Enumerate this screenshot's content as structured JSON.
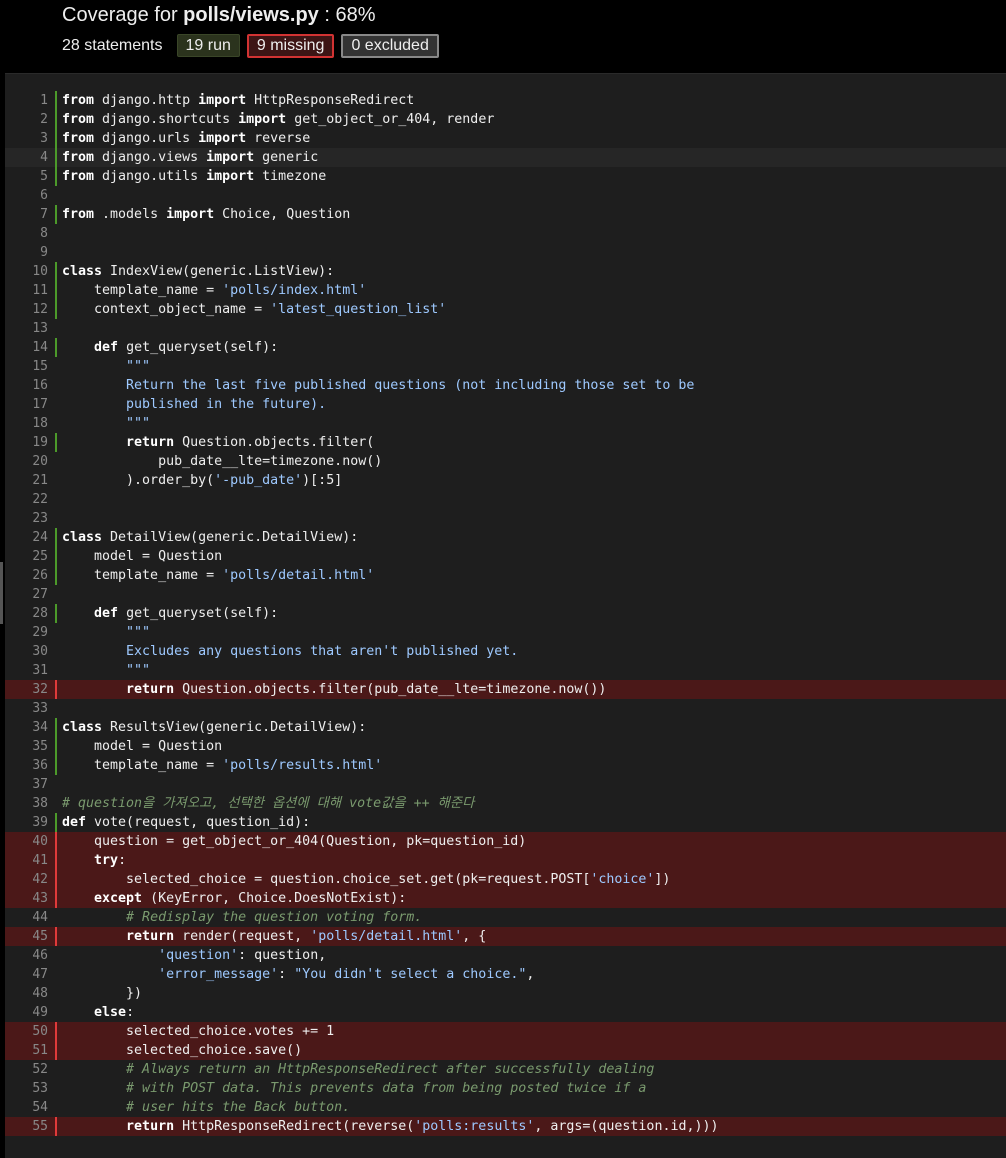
{
  "header": {
    "title_prefix": "Coverage for ",
    "file": "polls/views.py",
    "title_suffix": " : 68%",
    "statements": "28 statements",
    "run_button": "19 run",
    "missing_button": "9 missing",
    "excluded_button": "0 excluded"
  },
  "code": [
    {
      "n": "1",
      "st": "run",
      "toks": [
        [
          "k",
          "from"
        ],
        [
          "p",
          " django.http "
        ],
        [
          "k",
          "import"
        ],
        [
          "p",
          " HttpResponseRedirect"
        ]
      ]
    },
    {
      "n": "2",
      "st": "run",
      "toks": [
        [
          "k",
          "from"
        ],
        [
          "p",
          " django.shortcuts "
        ],
        [
          "k",
          "import"
        ],
        [
          "p",
          " get_object_or_404, render"
        ]
      ]
    },
    {
      "n": "3",
      "st": "run",
      "toks": [
        [
          "k",
          "from"
        ],
        [
          "p",
          " django.urls "
        ],
        [
          "k",
          "import"
        ],
        [
          "p",
          " reverse"
        ]
      ]
    },
    {
      "n": "4",
      "st": "run",
      "hl": true,
      "toks": [
        [
          "k",
          "from"
        ],
        [
          "p",
          " django.views "
        ],
        [
          "k",
          "import"
        ],
        [
          "p",
          " generic"
        ]
      ]
    },
    {
      "n": "5",
      "st": "run",
      "toks": [
        [
          "k",
          "from"
        ],
        [
          "p",
          " django.utils "
        ],
        [
          "k",
          "import"
        ],
        [
          "p",
          " timezone"
        ]
      ]
    },
    {
      "n": "6",
      "st": "",
      "toks": []
    },
    {
      "n": "7",
      "st": "run",
      "toks": [
        [
          "k",
          "from"
        ],
        [
          "p",
          " .models "
        ],
        [
          "k",
          "import"
        ],
        [
          "p",
          " Choice, Question"
        ]
      ]
    },
    {
      "n": "8",
      "st": "",
      "toks": []
    },
    {
      "n": "9",
      "st": "",
      "toks": []
    },
    {
      "n": "10",
      "st": "run",
      "toks": [
        [
          "k",
          "class"
        ],
        [
          "p",
          " IndexView(generic.ListView):"
        ]
      ]
    },
    {
      "n": "11",
      "st": "run",
      "toks": [
        [
          "p",
          "    template_name = "
        ],
        [
          "s",
          "'polls/index.html'"
        ]
      ]
    },
    {
      "n": "12",
      "st": "run",
      "toks": [
        [
          "p",
          "    context_object_name = "
        ],
        [
          "s",
          "'latest_question_list'"
        ]
      ]
    },
    {
      "n": "13",
      "st": "",
      "toks": []
    },
    {
      "n": "14",
      "st": "run",
      "toks": [
        [
          "p",
          "    "
        ],
        [
          "k",
          "def"
        ],
        [
          "p",
          " get_queryset(self):"
        ]
      ]
    },
    {
      "n": "15",
      "st": "",
      "toks": [
        [
          "p",
          "        "
        ],
        [
          "s",
          "\"\"\""
        ]
      ]
    },
    {
      "n": "16",
      "st": "",
      "toks": [
        [
          "s",
          "        Return the last five published questions (not including those set to be"
        ]
      ]
    },
    {
      "n": "17",
      "st": "",
      "toks": [
        [
          "s",
          "        published in the future)."
        ]
      ]
    },
    {
      "n": "18",
      "st": "",
      "toks": [
        [
          "p",
          "        "
        ],
        [
          "s",
          "\"\"\""
        ]
      ]
    },
    {
      "n": "19",
      "st": "run",
      "toks": [
        [
          "p",
          "        "
        ],
        [
          "k",
          "return"
        ],
        [
          "p",
          " Question.objects.filter("
        ]
      ]
    },
    {
      "n": "20",
      "st": "",
      "toks": [
        [
          "p",
          "            pub_date__lte=timezone.now()"
        ]
      ]
    },
    {
      "n": "21",
      "st": "",
      "toks": [
        [
          "p",
          "        ).order_by("
        ],
        [
          "s",
          "'-pub_date'"
        ],
        [
          "p",
          ")[:5]"
        ]
      ]
    },
    {
      "n": "22",
      "st": "",
      "toks": []
    },
    {
      "n": "23",
      "st": "",
      "toks": []
    },
    {
      "n": "24",
      "st": "run",
      "toks": [
        [
          "k",
          "class"
        ],
        [
          "p",
          " DetailView(generic.DetailView):"
        ]
      ]
    },
    {
      "n": "25",
      "st": "run",
      "toks": [
        [
          "p",
          "    model = Question"
        ]
      ]
    },
    {
      "n": "26",
      "st": "run",
      "toks": [
        [
          "p",
          "    template_name = "
        ],
        [
          "s",
          "'polls/detail.html'"
        ]
      ]
    },
    {
      "n": "27",
      "st": "",
      "toks": []
    },
    {
      "n": "28",
      "st": "run",
      "toks": [
        [
          "p",
          "    "
        ],
        [
          "k",
          "def"
        ],
        [
          "p",
          " get_queryset(self):"
        ]
      ]
    },
    {
      "n": "29",
      "st": "",
      "toks": [
        [
          "p",
          "        "
        ],
        [
          "s",
          "\"\"\""
        ]
      ]
    },
    {
      "n": "30",
      "st": "",
      "toks": [
        [
          "s",
          "        Excludes any questions that aren't published yet."
        ]
      ]
    },
    {
      "n": "31",
      "st": "",
      "toks": [
        [
          "p",
          "        "
        ],
        [
          "s",
          "\"\"\""
        ]
      ]
    },
    {
      "n": "32",
      "st": "mis",
      "toks": [
        [
          "p",
          "        "
        ],
        [
          "k",
          "return"
        ],
        [
          "p",
          " Question.objects.filter(pub_date__lte=timezone.now())"
        ]
      ]
    },
    {
      "n": "33",
      "st": "",
      "toks": []
    },
    {
      "n": "34",
      "st": "run",
      "toks": [
        [
          "k",
          "class"
        ],
        [
          "p",
          " ResultsView(generic.DetailView):"
        ]
      ]
    },
    {
      "n": "35",
      "st": "run",
      "toks": [
        [
          "p",
          "    model = Question"
        ]
      ]
    },
    {
      "n": "36",
      "st": "run",
      "toks": [
        [
          "p",
          "    template_name = "
        ],
        [
          "s",
          "'polls/results.html'"
        ]
      ]
    },
    {
      "n": "37",
      "st": "",
      "toks": []
    },
    {
      "n": "38",
      "st": "",
      "toks": [
        [
          "c",
          "# question을 가져오고, 선택한 옵션에 대해 vote값을 ++ 해준다"
        ]
      ]
    },
    {
      "n": "39",
      "st": "run",
      "toks": [
        [
          "k",
          "def"
        ],
        [
          "p",
          " vote(request, question_id):"
        ]
      ]
    },
    {
      "n": "40",
      "st": "mis",
      "toks": [
        [
          "p",
          "    question = get_object_or_404(Question, pk=question_id)"
        ]
      ]
    },
    {
      "n": "41",
      "st": "mis",
      "toks": [
        [
          "p",
          "    "
        ],
        [
          "k",
          "try"
        ],
        [
          "p",
          ":"
        ]
      ]
    },
    {
      "n": "42",
      "st": "mis",
      "toks": [
        [
          "p",
          "        selected_choice = question.choice_set.get(pk=request.POST["
        ],
        [
          "s",
          "'choice'"
        ],
        [
          "p",
          "])"
        ]
      ]
    },
    {
      "n": "43",
      "st": "mis",
      "toks": [
        [
          "p",
          "    "
        ],
        [
          "k",
          "except"
        ],
        [
          "p",
          " (KeyError, Choice.DoesNotExist):"
        ]
      ]
    },
    {
      "n": "44",
      "st": "",
      "toks": [
        [
          "p",
          "        "
        ],
        [
          "c",
          "# Redisplay the question voting form."
        ]
      ]
    },
    {
      "n": "45",
      "st": "mis",
      "toks": [
        [
          "p",
          "        "
        ],
        [
          "k",
          "return"
        ],
        [
          "p",
          " render(request, "
        ],
        [
          "s",
          "'polls/detail.html'"
        ],
        [
          "p",
          ", {"
        ]
      ]
    },
    {
      "n": "46",
      "st": "",
      "toks": [
        [
          "p",
          "            "
        ],
        [
          "s",
          "'question'"
        ],
        [
          "p",
          ": question,"
        ]
      ]
    },
    {
      "n": "47",
      "st": "",
      "toks": [
        [
          "p",
          "            "
        ],
        [
          "s",
          "'error_message'"
        ],
        [
          "p",
          ": "
        ],
        [
          "s",
          "\"You didn't select a choice.\""
        ],
        [
          "p",
          ","
        ]
      ]
    },
    {
      "n": "48",
      "st": "",
      "toks": [
        [
          "p",
          "        })"
        ]
      ]
    },
    {
      "n": "49",
      "st": "",
      "toks": [
        [
          "p",
          "    "
        ],
        [
          "k",
          "else"
        ],
        [
          "p",
          ":"
        ]
      ]
    },
    {
      "n": "50",
      "st": "mis",
      "toks": [
        [
          "p",
          "        selected_choice.votes += 1"
        ]
      ]
    },
    {
      "n": "51",
      "st": "mis",
      "toks": [
        [
          "p",
          "        selected_choice.save()"
        ]
      ]
    },
    {
      "n": "52",
      "st": "",
      "toks": [
        [
          "p",
          "        "
        ],
        [
          "c",
          "# Always return an HttpResponseRedirect after successfully dealing"
        ]
      ]
    },
    {
      "n": "53",
      "st": "",
      "toks": [
        [
          "p",
          "        "
        ],
        [
          "c",
          "# with POST data. This prevents data from being posted twice if a"
        ]
      ]
    },
    {
      "n": "54",
      "st": "",
      "toks": [
        [
          "p",
          "        "
        ],
        [
          "c",
          "# user hits the Back button."
        ]
      ]
    },
    {
      "n": "55",
      "st": "mis",
      "toks": [
        [
          "p",
          "        "
        ],
        [
          "k",
          "return"
        ],
        [
          "p",
          " HttpResponseRedirect(reverse("
        ],
        [
          "s",
          "'polls:results'"
        ],
        [
          "p",
          ", args=(question.id,)))"
        ]
      ]
    }
  ]
}
